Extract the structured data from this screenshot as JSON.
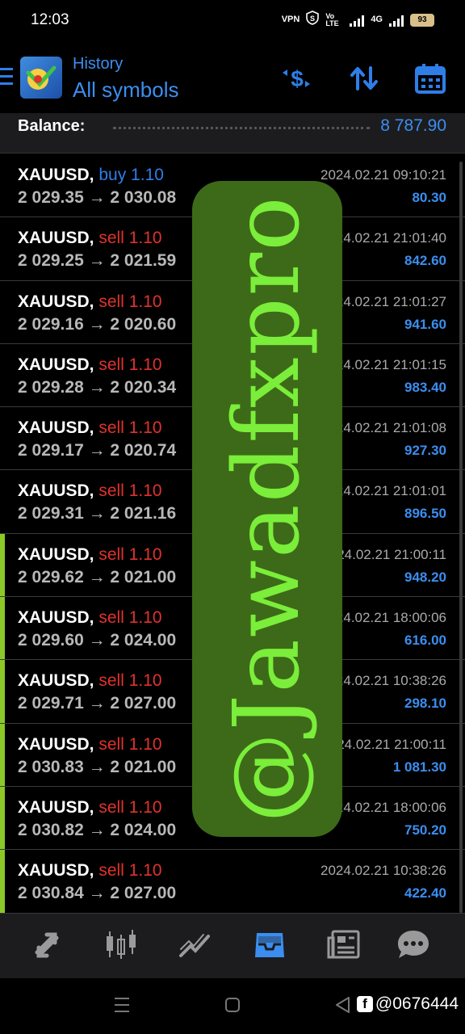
{
  "status": {
    "time": "12:03",
    "vpn": "VPN",
    "volte": "Vo LTE",
    "network": "4G",
    "battery": "93"
  },
  "header": {
    "subtitle": "History",
    "title": "All symbols"
  },
  "balance": {
    "label": "Balance:",
    "value": "8 787.90"
  },
  "trades": [
    {
      "symbol": "XAUUSD,",
      "side": "buy",
      "volume": "buy 1.10",
      "prices": "2 029.35 → 2 030.08",
      "time": "2024.02.21 09:10:21",
      "profit": "80.30",
      "accent": false
    },
    {
      "symbol": "XAUUSD,",
      "side": "sell",
      "volume": "sell 1.10",
      "prices": "2 029.25 → 2 021.59",
      "time": "2024.02.21 21:01:40",
      "profit": "842.60",
      "accent": false
    },
    {
      "symbol": "XAUUSD,",
      "side": "sell",
      "volume": "sell 1.10",
      "prices": "2 029.16 → 2 020.60",
      "time": "2024.02.21 21:01:27",
      "profit": "941.60",
      "accent": false
    },
    {
      "symbol": "XAUUSD,",
      "side": "sell",
      "volume": "sell 1.10",
      "prices": "2 029.28 → 2 020.34",
      "time": "2024.02.21 21:01:15",
      "profit": "983.40",
      "accent": false
    },
    {
      "symbol": "XAUUSD,",
      "side": "sell",
      "volume": "sell 1.10",
      "prices": "2 029.17 → 2 020.74",
      "time": "2024.02.21 21:01:08",
      "profit": "927.30",
      "accent": false
    },
    {
      "symbol": "XAUUSD,",
      "side": "sell",
      "volume": "sell 1.10",
      "prices": "2 029.31 → 2 021.16",
      "time": "2024.02.21 21:01:01",
      "profit": "896.50",
      "accent": false
    },
    {
      "symbol": "XAUUSD,",
      "side": "sell",
      "volume": "sell 1.10",
      "prices": "2 029.62 → 2 021.00",
      "time": "2024.02.21 21:00:11",
      "profit": "948.20",
      "accent": true
    },
    {
      "symbol": "XAUUSD,",
      "side": "sell",
      "volume": "sell 1.10",
      "prices": "2 029.60 → 2 024.00",
      "time": "2024.02.21 18:00:06",
      "profit": "616.00",
      "accent": true
    },
    {
      "symbol": "XAUUSD,",
      "side": "sell",
      "volume": "sell 1.10",
      "prices": "2 029.71 → 2 027.00",
      "time": "2024.02.21 10:38:26",
      "profit": "298.10",
      "accent": true
    },
    {
      "symbol": "XAUUSD,",
      "side": "sell",
      "volume": "sell 1.10",
      "prices": "2 030.83 → 2 021.00",
      "time": "2024.02.21 21:00:11",
      "profit": "1 081.30",
      "accent": true
    },
    {
      "symbol": "XAUUSD,",
      "side": "sell",
      "volume": "sell 1.10",
      "prices": "2 030.82 → 2 024.00",
      "time": "2024.02.21 18:00:06",
      "profit": "750.20",
      "accent": true
    },
    {
      "symbol": "XAUUSD,",
      "side": "sell",
      "volume": "sell 1.10",
      "prices": "2 030.84 → 2 027.00",
      "time": "2024.02.21 10:38:26",
      "profit": "422.40",
      "accent": true
    }
  ],
  "watermark": {
    "text": "@Jawadfxpro"
  },
  "bottom_nav": [
    "quotes-icon",
    "chart-icon",
    "trade-icon",
    "history-icon",
    "news-icon",
    "chat-icon"
  ],
  "footer_tag": {
    "text": "@0676444",
    "icon": "facebook-icon"
  },
  "colors": {
    "accent_blue": "#3b8ef0",
    "buy": "#2f7ee8",
    "sell": "#e0322d",
    "row_accent": "#8ac926",
    "watermark_bg": "#3d6a18",
    "watermark_text": "#7aee3a"
  }
}
